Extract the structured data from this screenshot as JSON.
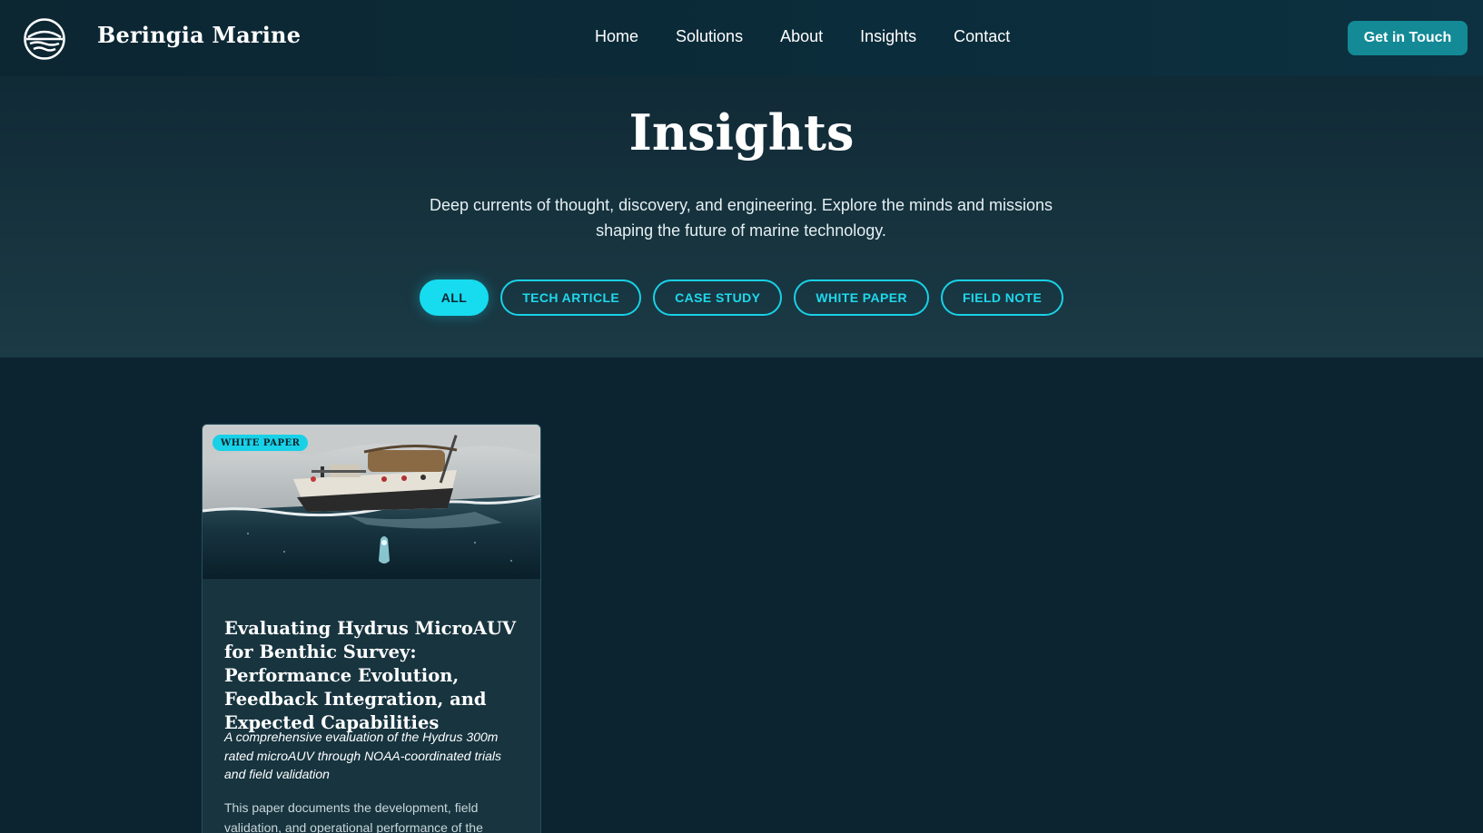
{
  "header": {
    "brand": "Beringia Marine",
    "nav": [
      "Home",
      "Solutions",
      "About",
      "Insights",
      "Contact"
    ],
    "cta_label": "Get in Touch"
  },
  "hero": {
    "title": "Insights",
    "subtitle": "Deep currents of thought, discovery, and engineering. Explore the minds and missions shaping the future of marine technology.",
    "filters": [
      "ALL",
      "TECH ARTICLE",
      "CASE STUDY",
      "WHITE PAPER",
      "FIELD NOTE"
    ],
    "active_filter": "ALL"
  },
  "articles": [
    {
      "badge": "WHITE PAPER",
      "title": "Evaluating Hydrus MicroAUV for Benthic Survey: Performance Evolution, Feedback Integration, and Expected Capabilities",
      "summary": "A comprehensive evaluation of the Hydrus 300m rated microAUV through NOAA-coordinated trials and field validation",
      "body": "This paper documents the development, field validation, and operational performance of the"
    }
  ],
  "colors": {
    "background": "#0b2430",
    "accent": "#17dcf0",
    "cta": "#138a96",
    "card": "#17343f"
  }
}
